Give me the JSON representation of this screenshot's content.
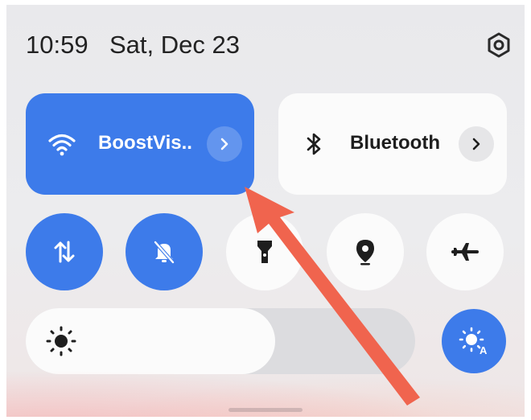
{
  "status": {
    "time": "10:59",
    "date": "Sat, Dec 23",
    "settings_icon": "settings-hexagon-icon"
  },
  "tiles": {
    "wifi": {
      "label": "BoostVis..",
      "icon": "wifi-icon",
      "state": "on",
      "has_details": true
    },
    "bluetooth": {
      "label": "Bluetooth",
      "icon": "bluetooth-icon",
      "state": "off",
      "has_details": true
    }
  },
  "toggles": [
    {
      "name": "mobile-data",
      "icon": "data-arrows-icon",
      "state": "on"
    },
    {
      "name": "do-not-disturb",
      "icon": "bell-off-icon",
      "state": "on"
    },
    {
      "name": "flashlight",
      "icon": "flashlight-icon",
      "state": "off"
    },
    {
      "name": "location",
      "icon": "location-pin-icon",
      "state": "off"
    },
    {
      "name": "airplane-mode",
      "icon": "airplane-icon",
      "state": "off"
    }
  ],
  "brightness": {
    "level_fraction": 0.64,
    "icon": "sun-icon"
  },
  "auto_brightness": {
    "icon": "auto-brightness-icon",
    "state": "on"
  },
  "colors": {
    "accent": "#3d7bea",
    "tile_off": "#fbfbfb",
    "annotation_arrow": "#f0644e"
  }
}
